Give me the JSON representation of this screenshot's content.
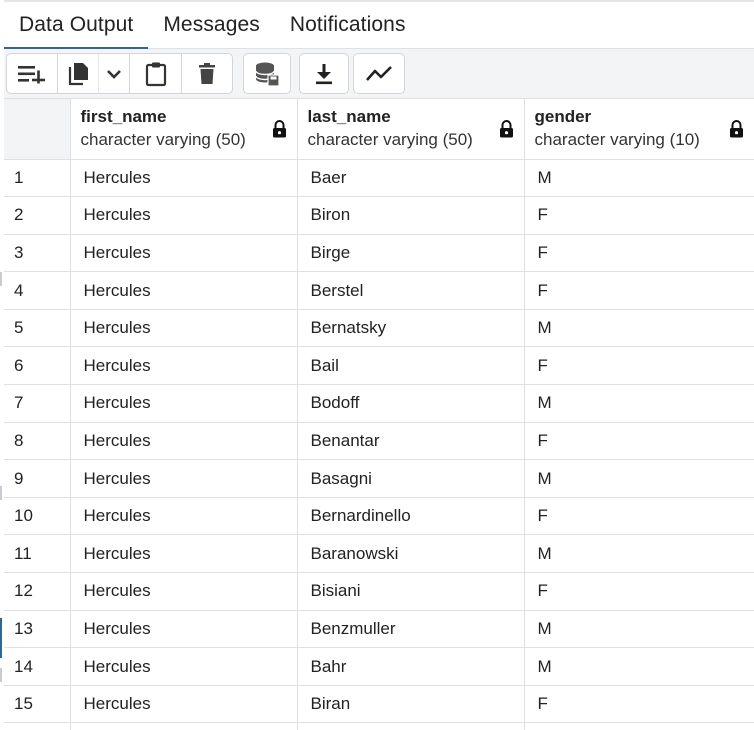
{
  "tabs": [
    {
      "label": "Data Output",
      "active": true
    },
    {
      "label": "Messages",
      "active": false
    },
    {
      "label": "Notifications",
      "active": false
    }
  ],
  "toolbar": {
    "buttons": [
      "add-row-icon",
      "copy-icon",
      "chevron-down-icon",
      "paste-icon",
      "delete-icon",
      "save-data-icon",
      "download-icon",
      "graph-visualiser-icon"
    ]
  },
  "colors": {
    "active_tab_underline": "#326690",
    "toolbar_bg": "#f3f4f6",
    "grid_border": "#dde0e5"
  },
  "columns": [
    {
      "name": "first_name",
      "type": "character varying (50)"
    },
    {
      "name": "last_name",
      "type": "character varying (50)"
    },
    {
      "name": "gender",
      "type": "character varying (10)"
    }
  ],
  "rows": [
    {
      "num": "1",
      "first_name": "Hercules",
      "last_name": "Baer",
      "gender": "M"
    },
    {
      "num": "2",
      "first_name": "Hercules",
      "last_name": "Biron",
      "gender": "F"
    },
    {
      "num": "3",
      "first_name": "Hercules",
      "last_name": "Birge",
      "gender": "F"
    },
    {
      "num": "4",
      "first_name": "Hercules",
      "last_name": "Berstel",
      "gender": "F"
    },
    {
      "num": "5",
      "first_name": "Hercules",
      "last_name": "Bernatsky",
      "gender": "M"
    },
    {
      "num": "6",
      "first_name": "Hercules",
      "last_name": "Bail",
      "gender": "F"
    },
    {
      "num": "7",
      "first_name": "Hercules",
      "last_name": "Bodoff",
      "gender": "M"
    },
    {
      "num": "8",
      "first_name": "Hercules",
      "last_name": "Benantar",
      "gender": "F"
    },
    {
      "num": "9",
      "first_name": "Hercules",
      "last_name": "Basagni",
      "gender": "M"
    },
    {
      "num": "10",
      "first_name": "Hercules",
      "last_name": "Bernardinello",
      "gender": "F"
    },
    {
      "num": "11",
      "first_name": "Hercules",
      "last_name": "Baranowski",
      "gender": "M"
    },
    {
      "num": "12",
      "first_name": "Hercules",
      "last_name": "Bisiani",
      "gender": "F"
    },
    {
      "num": "13",
      "first_name": "Hercules",
      "last_name": "Benzmuller",
      "gender": "M"
    },
    {
      "num": "14",
      "first_name": "Hercules",
      "last_name": "Bahr",
      "gender": "M"
    },
    {
      "num": "15",
      "first_name": "Hercules",
      "last_name": "Biran",
      "gender": "F"
    },
    {
      "num": "",
      "first_name": "",
      "last_name": "",
      "gender": ""
    }
  ]
}
